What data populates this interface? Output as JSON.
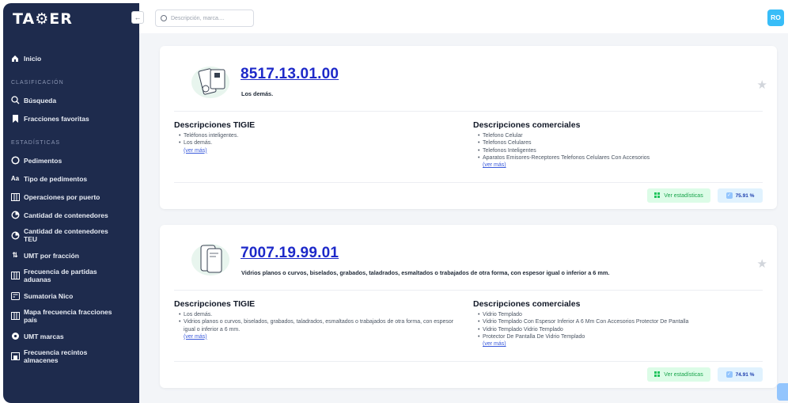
{
  "app": {
    "logo": "TA⚙ER"
  },
  "sidebar": {
    "collapse_icon": "←",
    "home": "Inicio",
    "section_clasificacion": "CLASIFICACIÓN",
    "busqueda": "Búsqueda",
    "favoritas": "Fracciones favoritas",
    "section_estadisticas": "ESTADÍSTICAS",
    "pedimentos": "Pedimentos",
    "tipo_pedimentos": "Tipo de pedimentos",
    "tipo_icon_text": "Aa",
    "operaciones_puerto": "Operaciones por puerto",
    "cantidad_contenedores": "Cantidad de contenedores",
    "cantidad_contenedores_teu_1": "Cantidad de contenedores",
    "cantidad_contenedores_teu_2": "TEU",
    "umt_fraccion": "UMT por fracción",
    "frecuencia_partidas_1": "Frecuencia de partidas",
    "frecuencia_partidas_2": "aduanas",
    "sumatoria_nico": "Sumatoria Nico",
    "mapa_frecuencia_1": "Mapa frecuencia fracciones",
    "mapa_frecuencia_2": "país",
    "umt_marcas": "UMT marcas",
    "frecuencia_recintos_1": "Frecuencia recintos",
    "frecuencia_recintos_2": "almacenes"
  },
  "topbar": {
    "search_placeholder": "Descripción, marca....",
    "avatar": "RO"
  },
  "cards": [
    {
      "code": "8517.13.01.00",
      "description": "Los demás.",
      "tigie_title": "Descripciones TIGIE",
      "tigie_items": [
        "Teléfonos inteligentes.",
        "Los demás."
      ],
      "tigie_more": "(ver más)",
      "comercial_title": "Descripciones comerciales",
      "comercial_items": [
        "Telefono Celular",
        "Telefonos Celulares",
        "Telefonos Inteligentes",
        "Aparatos Emisores-Receptores Telefonos Celulares Con Accesorios"
      ],
      "comercial_more": "(ver más)",
      "stats_label": "Ver estadísticas",
      "score": "75.91 %"
    },
    {
      "code": "7007.19.99.01",
      "description": "Vidrios planos o curvos, biselados, grabados, taladrados, esmaltados o trabajados de otra forma, con espesor igual o inferior a 6 mm.",
      "tigie_title": "Descripciones TIGIE",
      "tigie_items": [
        "Los demás.",
        "Vidrios planos o curvos, biselados, grabados, taladrados, esmaltados o trabajados de otra forma, con espesor igual o inferior a 6 mm."
      ],
      "tigie_more": "(ver más)",
      "comercial_title": "Descripciones comerciales",
      "comercial_items": [
        "Vidrio Templado",
        "Vidrio Templado Con Espesor Inferior A 6 Mm Con Accesorios Protector De Pantalla",
        "Vidrio Templado Vidrio Templado",
        "Protector De Pantalla De Vidrio Templado"
      ],
      "comercial_more": "(ver más)",
      "stats_label": "Ver estadísticas",
      "score": "74.91 %"
    }
  ],
  "colors": {
    "sidebar_bg": "#1e2b4d",
    "link": "#1d29c9",
    "avatar": "#38bdf8",
    "stats": "#22c55e"
  }
}
